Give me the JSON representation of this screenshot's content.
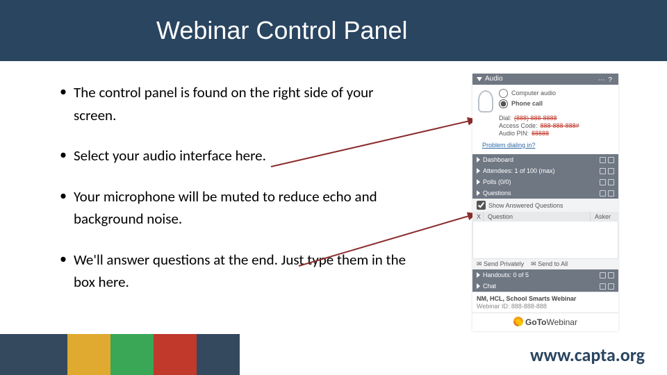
{
  "header": {
    "title": "Webinar Control Panel"
  },
  "bullets": [
    "The control panel is found on the right side of your screen.",
    "Select your audio interface here.",
    "Your microphone will be muted to reduce echo and background noise.",
    "We'll answer questions at the end. Just type them in the box here."
  ],
  "panel": {
    "audio_title": "Audio",
    "computer_audio": "Computer audio",
    "phone_call": "Phone call",
    "dial_label": "Dial:",
    "dial_value": "(888) 888-8888",
    "access_label": "Access Code:",
    "access_value": "888-888-888#",
    "pin_label": "Audio PIN:",
    "pin_value": "88888",
    "problem_link": "Problem dialing in?",
    "mini_bars": {
      "dashboard": "Dashboard",
      "attendees": "Attendees: 1 of 100 (max)",
      "polls": "Polls (0/0)",
      "questions": "Questions"
    },
    "show_answered": "Show Answered Questions",
    "col_x": "X",
    "col_q": "Question",
    "col_a": "Asker",
    "send_priv": "Send Privately",
    "send_all": "Send to All",
    "handouts": "Handouts: 0 of 5",
    "chat": "Chat",
    "meeting_title": "NM, HCL, School Smarts Webinar",
    "webinar_id": "Webinar ID: 888-888-888",
    "goto": {
      "go": "GoTo",
      "webinar": "Webinar"
    }
  },
  "footer": {
    "url": "www.capta.org"
  },
  "colors": {
    "header_bg": "#2a4560",
    "arrow": "#8b2d2d",
    "bars": [
      "#34495e",
      "#e0a92f",
      "#3aa757",
      "#c0392b",
      "#34495e"
    ]
  }
}
